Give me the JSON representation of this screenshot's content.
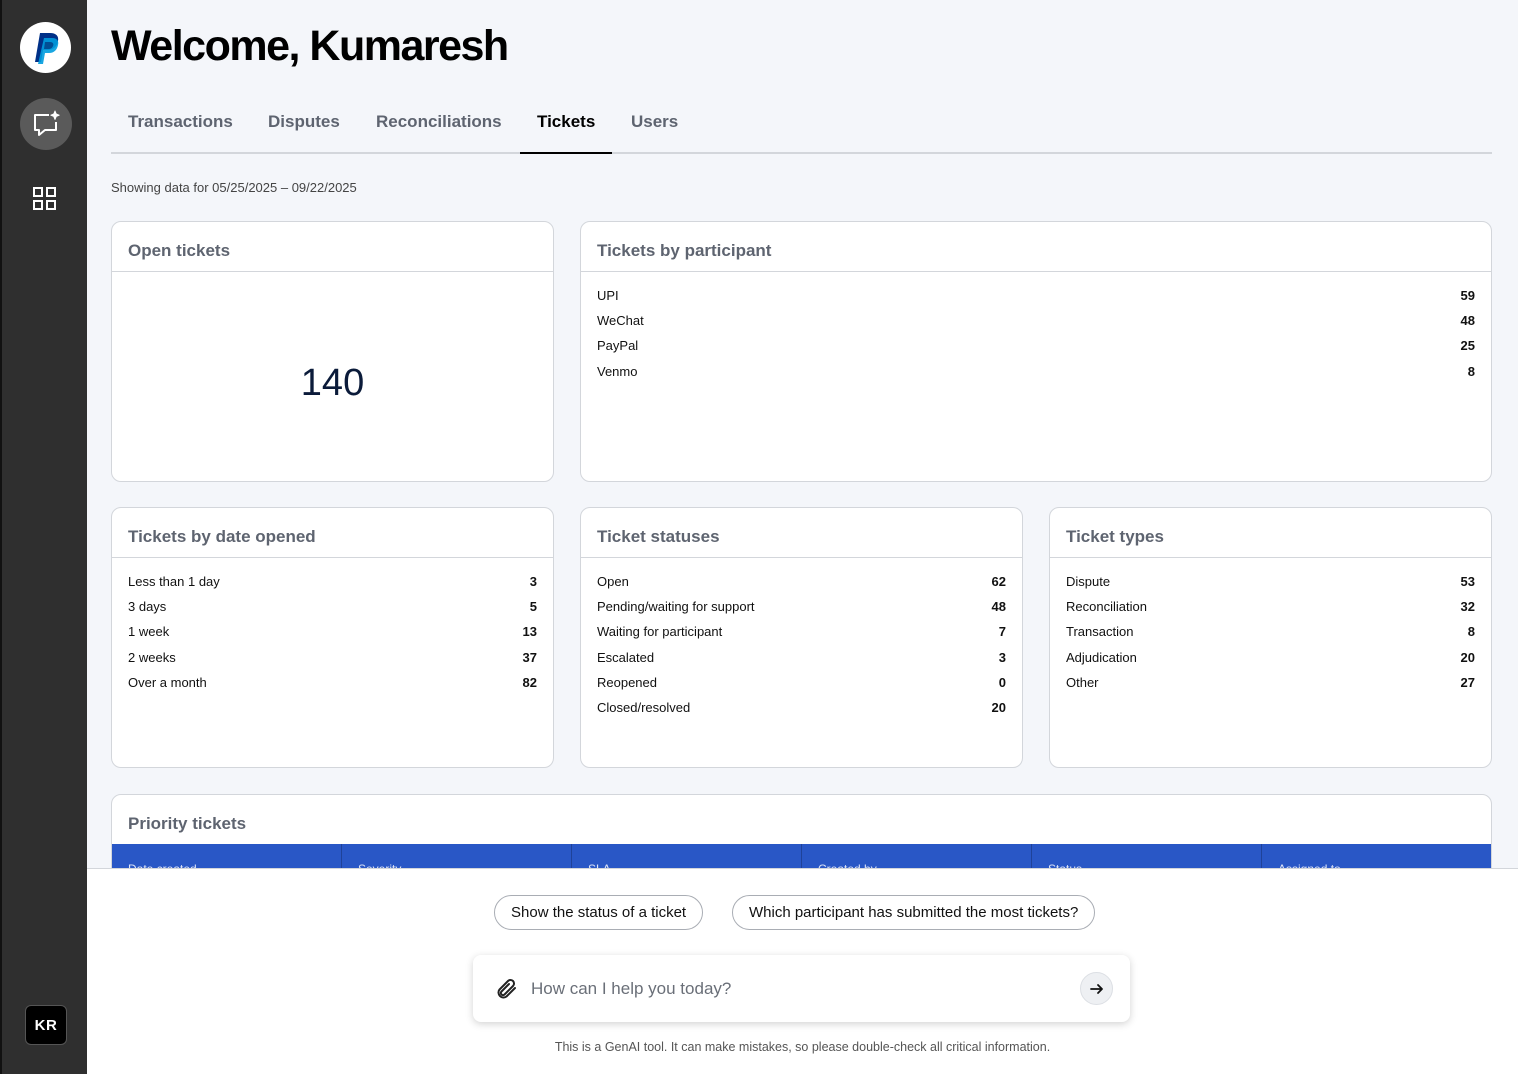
{
  "sidebar": {
    "logo_icon": "paypal-logo",
    "items": [
      {
        "name": "ai-chat",
        "icon": "chat-sparkle-icon",
        "active": true
      },
      {
        "name": "dashboard",
        "icon": "grid-icon",
        "active": false
      }
    ],
    "avatar_initials": "KR"
  },
  "header": {
    "title": "Welcome, Kumaresh"
  },
  "tabs": [
    {
      "label": "Transactions",
      "active": false
    },
    {
      "label": "Disputes",
      "active": false
    },
    {
      "label": "Reconciliations",
      "active": false
    },
    {
      "label": "Tickets",
      "active": true
    },
    {
      "label": "Users",
      "active": false
    }
  ],
  "date_range": "Showing data for 05/25/2025 – 09/22/2025",
  "cards": {
    "open_tickets": {
      "title": "Open tickets",
      "value": "140"
    },
    "by_participant": {
      "title": "Tickets by participant",
      "rows": [
        {
          "label": "UPI",
          "value": "59"
        },
        {
          "label": "WeChat",
          "value": "48"
        },
        {
          "label": "PayPal",
          "value": "25"
        },
        {
          "label": "Venmo",
          "value": "8"
        }
      ]
    },
    "by_date": {
      "title": "Tickets by date opened",
      "rows": [
        {
          "label": "Less than 1 day",
          "value": "3"
        },
        {
          "label": "3 days",
          "value": "5"
        },
        {
          "label": "1 week",
          "value": "13"
        },
        {
          "label": "2 weeks",
          "value": "37"
        },
        {
          "label": "Over a month",
          "value": "82"
        }
      ]
    },
    "statuses": {
      "title": "Ticket statuses",
      "rows": [
        {
          "label": "Open",
          "value": "62"
        },
        {
          "label": "Pending/waiting for support",
          "value": "48"
        },
        {
          "label": "Waiting for participant",
          "value": "7"
        },
        {
          "label": "Escalated",
          "value": "3"
        },
        {
          "label": "Reopened",
          "value": "0"
        },
        {
          "label": "Closed/resolved",
          "value": "20"
        }
      ]
    },
    "types": {
      "title": "Ticket types",
      "rows": [
        {
          "label": "Dispute",
          "value": "53"
        },
        {
          "label": "Reconciliation",
          "value": "32"
        },
        {
          "label": "Transaction",
          "value": "8"
        },
        {
          "label": "Adjudication",
          "value": "20"
        },
        {
          "label": "Other",
          "value": "27"
        }
      ]
    },
    "priority": {
      "title": "Priority tickets",
      "columns": [
        "Date created",
        "Severity",
        "SLA",
        "Created by",
        "Status",
        "Assigned to"
      ]
    }
  },
  "chat": {
    "suggestions": [
      "Show the status of a ticket",
      "Which participant has submitted the most tickets?"
    ],
    "placeholder": "How can I help you today?",
    "disclaimer": "This is a GenAI tool. It can make mistakes, so please double-check all critical information."
  },
  "colors": {
    "sidebar_bg": "#2f2f2f",
    "page_bg": "#f4f6fa",
    "table_header": "#2957c6",
    "paypal_dark": "#003087",
    "paypal_light": "#009cde"
  }
}
